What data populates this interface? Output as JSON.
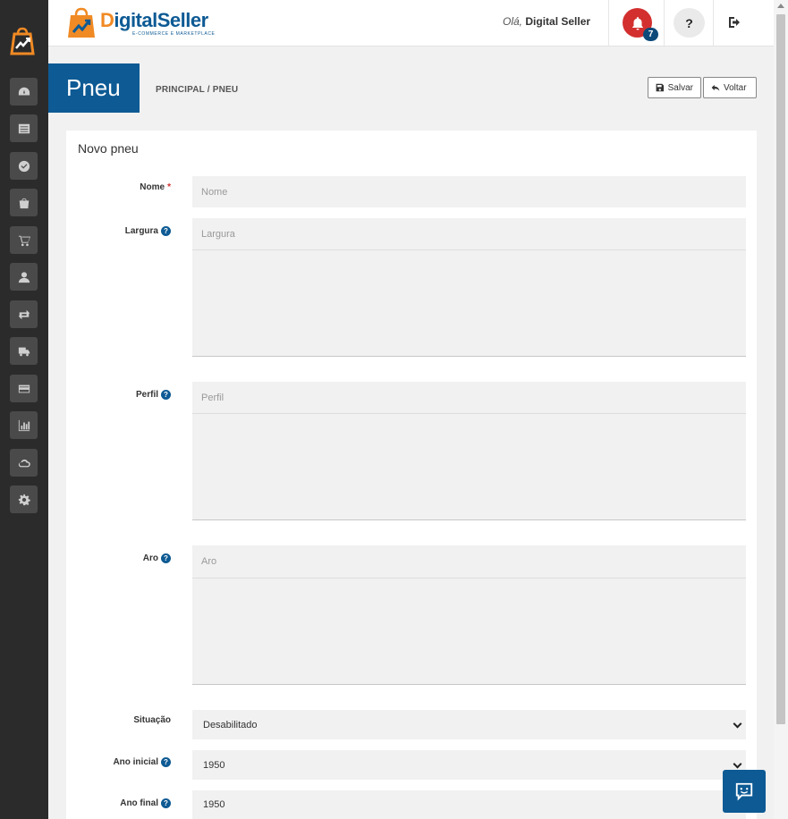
{
  "brand": {
    "logo_first": "D",
    "logo_rest": "igitalSeller",
    "logo_sub": "E-COMMERCE E MARKETPLACE",
    "accent": "#0d5a94",
    "orange": "#f08a24"
  },
  "header": {
    "greeting_prefix": "Olá,",
    "user_name": "Digital Seller",
    "notification_count": "7",
    "help_label": "?"
  },
  "sidebar": {
    "items": [
      {
        "icon": "dashboard-icon"
      },
      {
        "icon": "list-icon"
      },
      {
        "icon": "check-circle-icon"
      },
      {
        "icon": "shopping-bag-icon"
      },
      {
        "icon": "cart-icon"
      },
      {
        "icon": "user-icon"
      },
      {
        "icon": "exchange-icon"
      },
      {
        "icon": "truck-icon"
      },
      {
        "icon": "credit-card-icon"
      },
      {
        "icon": "bar-chart-icon"
      },
      {
        "icon": "cloud-icon"
      },
      {
        "icon": "gear-icon"
      }
    ]
  },
  "page": {
    "title": "Pneu",
    "breadcrumb": "PRINCIPAL / PNEU",
    "save_label": "Salvar",
    "back_label": "Voltar"
  },
  "form": {
    "title": "Novo pneu",
    "nome": {
      "label": "Nome",
      "required": "*",
      "placeholder": "Nome"
    },
    "largura": {
      "label": "Largura",
      "placeholder": "Largura"
    },
    "perfil": {
      "label": "Perfil",
      "placeholder": "Perfil"
    },
    "aro": {
      "label": "Aro",
      "placeholder": "Aro"
    },
    "situacao": {
      "label": "Situação",
      "value": "Desabilitado"
    },
    "ano_inicial": {
      "label": "Ano inicial",
      "value": "1950"
    },
    "ano_final": {
      "label": "Ano final",
      "value": "1950"
    },
    "help_glyph": "?"
  }
}
